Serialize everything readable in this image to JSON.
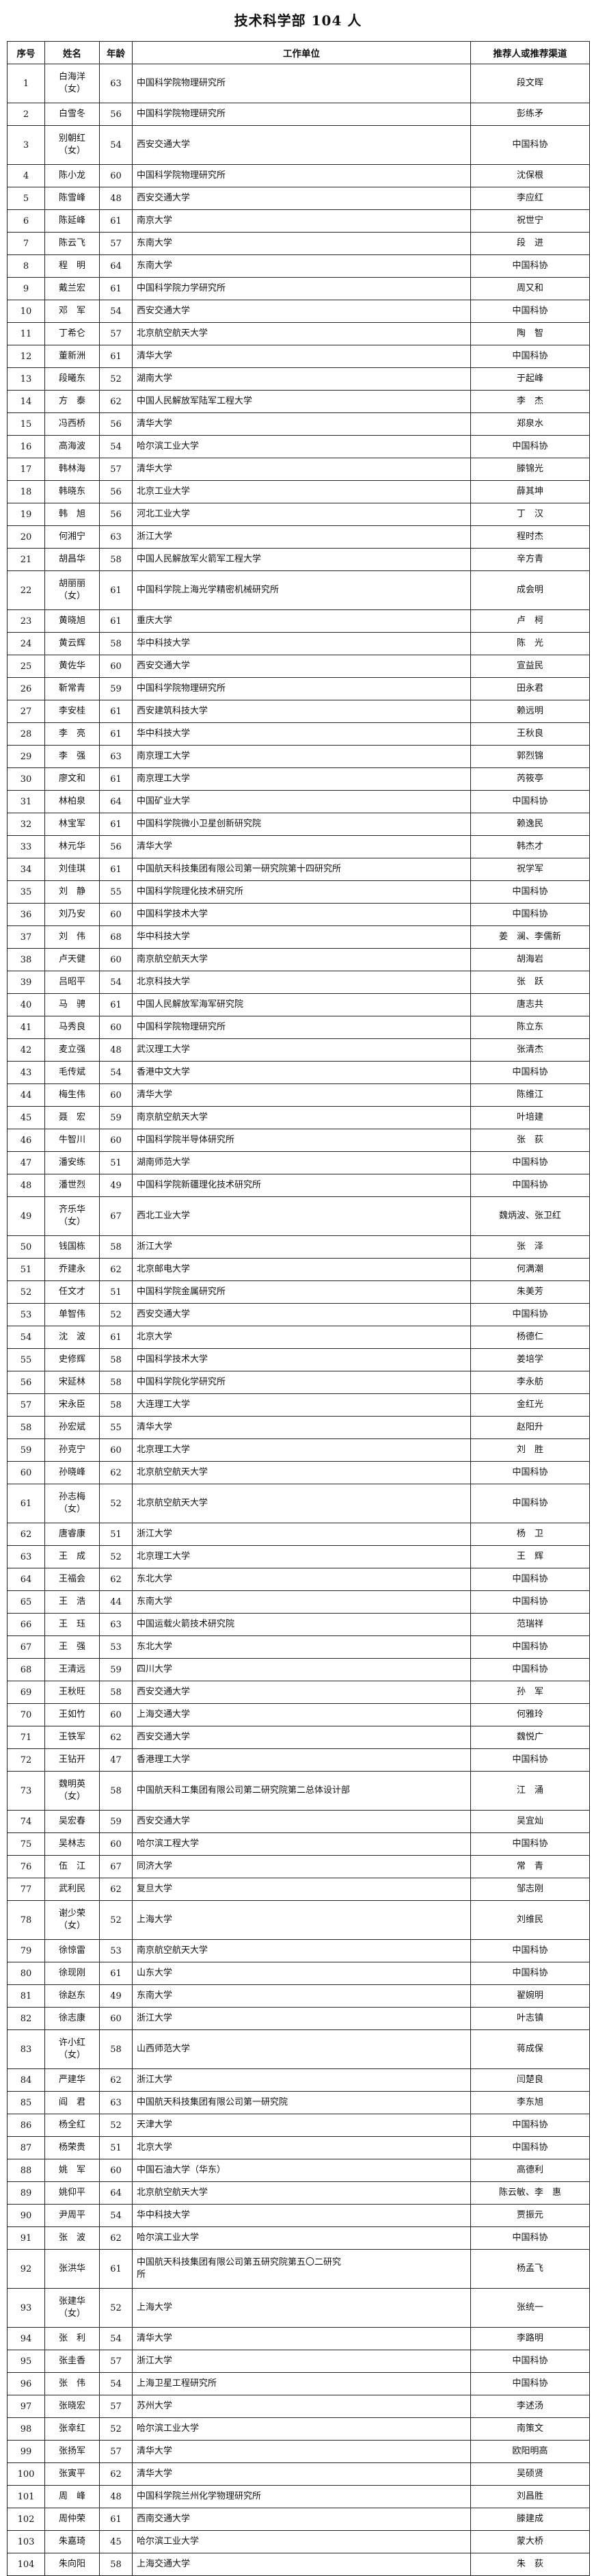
{
  "title": "技术科学部 104 人",
  "headers": {
    "no": "序号",
    "name": "姓名",
    "age": "年龄",
    "unit": "工作单位",
    "rec": "推荐人或推荐渠道"
  },
  "rows": [
    {
      "no": "1",
      "name": "白海洋\n（女）",
      "age": "63",
      "unit": "中国科学院物理研究所",
      "rec": "段文晖"
    },
    {
      "no": "2",
      "name": "白雪冬",
      "age": "56",
      "unit": "中国科学院物理研究所",
      "rec": "彭练矛"
    },
    {
      "no": "3",
      "name": "别朝红\n（女）",
      "age": "54",
      "unit": "西安交通大学",
      "rec": "中国科协"
    },
    {
      "no": "4",
      "name": "陈小龙",
      "age": "60",
      "unit": "中国科学院物理研究所",
      "rec": "沈保根"
    },
    {
      "no": "5",
      "name": "陈雪峰",
      "age": "48",
      "unit": "西安交通大学",
      "rec": "李应红"
    },
    {
      "no": "6",
      "name": "陈延峰",
      "age": "61",
      "unit": "南京大学",
      "rec": "祝世宁"
    },
    {
      "no": "7",
      "name": "陈云飞",
      "age": "57",
      "unit": "东南大学",
      "rec": "段　进"
    },
    {
      "no": "8",
      "name": "程　明",
      "age": "64",
      "unit": "东南大学",
      "rec": "中国科协"
    },
    {
      "no": "9",
      "name": "戴兰宏",
      "age": "61",
      "unit": "中国科学院力学研究所",
      "rec": "周又和"
    },
    {
      "no": "10",
      "name": "邓　军",
      "age": "54",
      "unit": "西安交通大学",
      "rec": "中国科协"
    },
    {
      "no": "11",
      "name": "丁希仑",
      "age": "57",
      "unit": "北京航空航天大学",
      "rec": "陶　智"
    },
    {
      "no": "12",
      "name": "董新洲",
      "age": "61",
      "unit": "清华大学",
      "rec": "中国科协"
    },
    {
      "no": "13",
      "name": "段曦东",
      "age": "52",
      "unit": "湖南大学",
      "rec": "于起峰"
    },
    {
      "no": "14",
      "name": "方　泰",
      "age": "62",
      "unit": "中国人民解放军陆军工程大学",
      "rec": "李　杰"
    },
    {
      "no": "15",
      "name": "冯西桥",
      "age": "56",
      "unit": "清华大学",
      "rec": "郑泉水"
    },
    {
      "no": "16",
      "name": "高海波",
      "age": "54",
      "unit": "哈尔滨工业大学",
      "rec": "中国科协"
    },
    {
      "no": "17",
      "name": "韩林海",
      "age": "57",
      "unit": "清华大学",
      "rec": "滕锦光"
    },
    {
      "no": "18",
      "name": "韩晓东",
      "age": "56",
      "unit": "北京工业大学",
      "rec": "薛其坤"
    },
    {
      "no": "19",
      "name": "韩　旭",
      "age": "56",
      "unit": "河北工业大学",
      "rec": "丁　汉"
    },
    {
      "no": "20",
      "name": "何湘宁",
      "age": "63",
      "unit": "浙江大学",
      "rec": "程时杰"
    },
    {
      "no": "21",
      "name": "胡昌华",
      "age": "58",
      "unit": "中国人民解放军火箭军工程大学",
      "rec": "辛方青"
    },
    {
      "no": "22",
      "name": "胡丽丽\n（女）",
      "age": "61",
      "unit": "中国科学院上海光学精密机械研究所",
      "rec": "成会明"
    },
    {
      "no": "23",
      "name": "黄晓旭",
      "age": "61",
      "unit": "重庆大学",
      "rec": "卢　柯"
    },
    {
      "no": "24",
      "name": "黄云辉",
      "age": "58",
      "unit": "华中科技大学",
      "rec": "陈　光"
    },
    {
      "no": "25",
      "name": "黄佐华",
      "age": "60",
      "unit": "西安交通大学",
      "rec": "宣益民"
    },
    {
      "no": "26",
      "name": "靳常青",
      "age": "59",
      "unit": "中国科学院物理研究所",
      "rec": "田永君"
    },
    {
      "no": "27",
      "name": "李安桂",
      "age": "61",
      "unit": "西安建筑科技大学",
      "rec": "赖远明"
    },
    {
      "no": "28",
      "name": "李　亮",
      "age": "61",
      "unit": "华中科技大学",
      "rec": "王秋良"
    },
    {
      "no": "29",
      "name": "李　强",
      "age": "63",
      "unit": "南京理工大学",
      "rec": "郭烈锦"
    },
    {
      "no": "30",
      "name": "廖文和",
      "age": "61",
      "unit": "南京理工大学",
      "rec": "芮筱亭"
    },
    {
      "no": "31",
      "name": "林柏泉",
      "age": "64",
      "unit": "中国矿业大学",
      "rec": "中国科协"
    },
    {
      "no": "32",
      "name": "林宝军",
      "age": "61",
      "unit": "中国科学院微小卫星创新研究院",
      "rec": "赖逸民"
    },
    {
      "no": "33",
      "name": "林元华",
      "age": "56",
      "unit": "清华大学",
      "rec": "韩杰才"
    },
    {
      "no": "34",
      "name": "刘佳琪",
      "age": "61",
      "unit": "中国航天科技集团有限公司第一研究院第十四研究所",
      "rec": "祝学军"
    },
    {
      "no": "35",
      "name": "刘　静",
      "age": "55",
      "unit": "中国科学院理化技术研究所",
      "rec": "中国科协"
    },
    {
      "no": "36",
      "name": "刘乃安",
      "age": "60",
      "unit": "中国科学技术大学",
      "rec": "中国科协"
    },
    {
      "no": "37",
      "name": "刘　伟",
      "age": "68",
      "unit": "华中科技大学",
      "rec": "姜　澜、李儒新"
    },
    {
      "no": "38",
      "name": "卢天健",
      "age": "60",
      "unit": "南京航空航天大学",
      "rec": "胡海岩"
    },
    {
      "no": "39",
      "name": "吕昭平",
      "age": "54",
      "unit": "北京科技大学",
      "rec": "张　跃"
    },
    {
      "no": "40",
      "name": "马　骋",
      "age": "61",
      "unit": "中国人民解放军海军研究院",
      "rec": "唐志共"
    },
    {
      "no": "41",
      "name": "马秀良",
      "age": "60",
      "unit": "中国科学院物理研究所",
      "rec": "陈立东"
    },
    {
      "no": "42",
      "name": "麦立强",
      "age": "48",
      "unit": "武汉理工大学",
      "rec": "张清杰"
    },
    {
      "no": "43",
      "name": "毛传斌",
      "age": "54",
      "unit": "香港中文大学",
      "rec": "中国科协"
    },
    {
      "no": "44",
      "name": "梅生伟",
      "age": "60",
      "unit": "清华大学",
      "rec": "陈维江"
    },
    {
      "no": "45",
      "name": "聂　宏",
      "age": "59",
      "unit": "南京航空航天大学",
      "rec": "叶培建"
    },
    {
      "no": "46",
      "name": "牛智川",
      "age": "60",
      "unit": "中国科学院半导体研究所",
      "rec": "张　荻"
    },
    {
      "no": "47",
      "name": "潘安练",
      "age": "51",
      "unit": "湖南师范大学",
      "rec": "中国科协"
    },
    {
      "no": "48",
      "name": "潘世烈",
      "age": "49",
      "unit": "中国科学院新疆理化技术研究所",
      "rec": "中国科协"
    },
    {
      "no": "49",
      "name": "齐乐华\n（女）",
      "age": "67",
      "unit": "西北工业大学",
      "rec": "魏炳波、张卫红"
    },
    {
      "no": "50",
      "name": "钱国栋",
      "age": "58",
      "unit": "浙江大学",
      "rec": "张　泽"
    },
    {
      "no": "51",
      "name": "乔建永",
      "age": "62",
      "unit": "北京邮电大学",
      "rec": "何满潮"
    },
    {
      "no": "52",
      "name": "任文才",
      "age": "51",
      "unit": "中国科学院金属研究所",
      "rec": "朱美芳"
    },
    {
      "no": "53",
      "name": "单智伟",
      "age": "52",
      "unit": "西安交通大学",
      "rec": "中国科协"
    },
    {
      "no": "54",
      "name": "沈　波",
      "age": "61",
      "unit": "北京大学",
      "rec": "杨德仁"
    },
    {
      "no": "55",
      "name": "史修辉",
      "age": "58",
      "unit": "中国科学技术大学",
      "rec": "姜培学"
    },
    {
      "no": "56",
      "name": "宋延林",
      "age": "58",
      "unit": "中国科学院化学研究所",
      "rec": "李永舫"
    },
    {
      "no": "57",
      "name": "宋永臣",
      "age": "58",
      "unit": "大连理工大学",
      "rec": "金红光"
    },
    {
      "no": "58",
      "name": "孙宏斌",
      "age": "55",
      "unit": "清华大学",
      "rec": "赵阳升"
    },
    {
      "no": "59",
      "name": "孙克宁",
      "age": "60",
      "unit": "北京理工大学",
      "rec": "刘　胜"
    },
    {
      "no": "60",
      "name": "孙晓峰",
      "age": "62",
      "unit": "北京航空航天大学",
      "rec": "中国科协"
    },
    {
      "no": "61",
      "name": "孙志梅\n（女）",
      "age": "52",
      "unit": "北京航空航天大学",
      "rec": "中国科协"
    },
    {
      "no": "62",
      "name": "唐睿康",
      "age": "51",
      "unit": "浙江大学",
      "rec": "杨　卫"
    },
    {
      "no": "63",
      "name": "王　成",
      "age": "52",
      "unit": "北京理工大学",
      "rec": "王　辉"
    },
    {
      "no": "64",
      "name": "王福会",
      "age": "62",
      "unit": "东北大学",
      "rec": "中国科协"
    },
    {
      "no": "65",
      "name": "王　浩",
      "age": "44",
      "unit": "东南大学",
      "rec": "中国科协"
    },
    {
      "no": "66",
      "name": "王　珏",
      "rec": "范瑞祥",
      "age": "63",
      "unit": "中国运载火箭技术研究院"
    },
    {
      "no": "67",
      "name": "王　强",
      "age": "53",
      "unit": "东北大学",
      "rec": "中国科协"
    },
    {
      "no": "68",
      "name": "王清远",
      "age": "59",
      "unit": "四川大学",
      "rec": "中国科协"
    },
    {
      "no": "69",
      "name": "王秋旺",
      "age": "58",
      "unit": "西安交通大学",
      "rec": "孙　军"
    },
    {
      "no": "70",
      "name": "王如竹",
      "age": "60",
      "unit": "上海交通大学",
      "rec": "何雅玲"
    },
    {
      "no": "71",
      "name": "王铁军",
      "age": "62",
      "unit": "西安交通大学",
      "rec": "魏悦广"
    },
    {
      "no": "72",
      "name": "王钻开",
      "age": "47",
      "unit": "香港理工大学",
      "rec": "中国科协"
    },
    {
      "no": "73",
      "name": "魏明英\n（女）",
      "age": "58",
      "unit": "中国航天科工集团有限公司第二研究院第二总体设计部",
      "rec": "江　涌"
    },
    {
      "no": "74",
      "name": "吴宏春",
      "age": "59",
      "unit": "西安交通大学",
      "rec": "吴宜灿"
    },
    {
      "no": "75",
      "name": "吴林志",
      "age": "60",
      "unit": "哈尔滨工程大学",
      "rec": "中国科协"
    },
    {
      "no": "76",
      "name": "伍　江",
      "age": "67",
      "unit": "同济大学",
      "rec": "常　青"
    },
    {
      "no": "77",
      "name": "武利民",
      "age": "62",
      "unit": "复旦大学",
      "rec": "邹志刚"
    },
    {
      "no": "78",
      "name": "谢少荣\n（女）",
      "age": "52",
      "unit": "上海大学",
      "rec": "刘维民"
    },
    {
      "no": "79",
      "name": "徐惊雷",
      "age": "53",
      "unit": "南京航空航天大学",
      "rec": "中国科协"
    },
    {
      "no": "80",
      "name": "徐现刚",
      "age": "61",
      "unit": "山东大学",
      "rec": "中国科协"
    },
    {
      "no": "81",
      "name": "徐赵东",
      "age": "49",
      "unit": "东南大学",
      "rec": "翟婉明"
    },
    {
      "no": "82",
      "name": "徐志康",
      "age": "60",
      "unit": "浙江大学",
      "rec": "叶志镇"
    },
    {
      "no": "83",
      "name": "许小红\n（女）",
      "age": "58",
      "unit": "山西师范大学",
      "rec": "蒋成保"
    },
    {
      "no": "84",
      "name": "严建华",
      "age": "62",
      "unit": "浙江大学",
      "rec": "闫楚良"
    },
    {
      "no": "85",
      "name": "阎　君",
      "age": "63",
      "unit": "中国航天科技集团有限公司第一研究院",
      "rec": "李东旭"
    },
    {
      "no": "86",
      "name": "杨全红",
      "age": "52",
      "unit": "天津大学",
      "rec": "中国科协"
    },
    {
      "no": "87",
      "name": "杨荣贵",
      "age": "51",
      "unit": "北京大学",
      "rec": "中国科协"
    },
    {
      "no": "88",
      "name": "姚　军",
      "age": "60",
      "unit": "中国石油大学（华东）",
      "rec": "高德利"
    },
    {
      "no": "89",
      "name": "姚仰平",
      "age": "64",
      "unit": "北京航空航天大学",
      "rec": "陈云敏、李　惠"
    },
    {
      "no": "90",
      "name": "尹周平",
      "age": "54",
      "unit": "华中科技大学",
      "rec": "贾振元"
    },
    {
      "no": "91",
      "name": "张　波",
      "age": "62",
      "unit": "哈尔滨工业大学",
      "rec": "中国科协"
    },
    {
      "no": "92",
      "name": "张洪华",
      "age": "61",
      "unit": "中国航天科技集团有限公司第五研究院第五〇二研究\n所",
      "rec": "杨孟飞"
    },
    {
      "no": "93",
      "name": "张建华\n（女）",
      "age": "52",
      "unit": "上海大学",
      "rec": "张统一"
    },
    {
      "no": "94",
      "name": "张　利",
      "age": "54",
      "unit": "清华大学",
      "rec": "李路明"
    },
    {
      "no": "95",
      "name": "张圭香",
      "age": "57",
      "unit": "浙江大学",
      "rec": "中国科协"
    },
    {
      "no": "96",
      "name": "张　伟",
      "age": "54",
      "unit": "上海卫星工程研究所",
      "rec": "中国科协"
    },
    {
      "no": "97",
      "name": "张晓宏",
      "age": "57",
      "unit": "苏州大学",
      "rec": "李述汤"
    },
    {
      "no": "98",
      "name": "张幸红",
      "age": "52",
      "unit": "哈尔滨工业大学",
      "rec": "南策文"
    },
    {
      "no": "99",
      "name": "张扬军",
      "age": "57",
      "unit": "清华大学",
      "rec": "欧阳明高"
    },
    {
      "no": "100",
      "name": "张寅平",
      "age": "62",
      "unit": "清华大学",
      "rec": "吴硕贤"
    },
    {
      "no": "101",
      "name": "周　峰",
      "age": "48",
      "unit": "中国科学院兰州化学物理研究所",
      "rec": "刘昌胜"
    },
    {
      "no": "102",
      "name": "周仲荣",
      "age": "61",
      "unit": "西南交通大学",
      "rec": "滕建成"
    },
    {
      "no": "103",
      "name": "朱嘉琦",
      "age": "45",
      "unit": "哈尔滨工业大学",
      "rec": "蒙大桥"
    },
    {
      "no": "104",
      "name": "朱向阳",
      "age": "58",
      "unit": "上海交通大学",
      "rec": "朱　荻"
    }
  ]
}
